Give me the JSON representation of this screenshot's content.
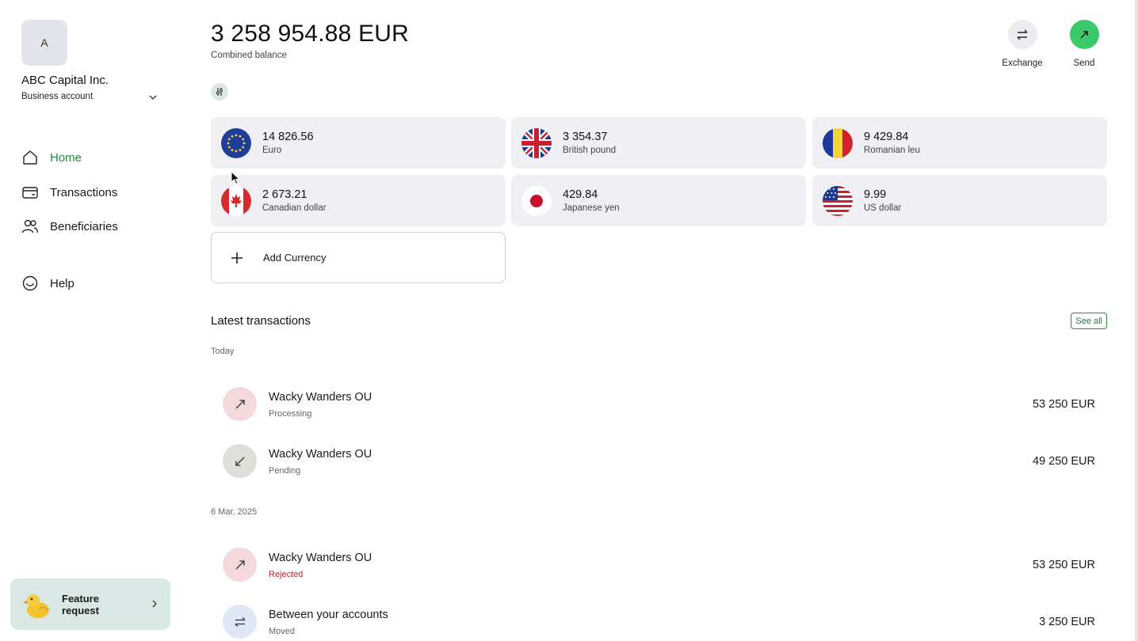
{
  "sidebar": {
    "avatar_letter": "A",
    "company_name": "ABC Capital Inc.",
    "account_type": "Business account",
    "nav": [
      {
        "label": "Home",
        "icon": "home-icon",
        "active": true
      },
      {
        "label": "Transactions",
        "icon": "card-icon"
      },
      {
        "label": "Beneficiaries",
        "icon": "users-icon"
      },
      {
        "label": "Help",
        "icon": "smiley-icon"
      }
    ],
    "feature_request": {
      "label": "Feature request",
      "icon": "duck-icon"
    }
  },
  "header": {
    "combined_balance": "3 258 954.88 EUR",
    "combined_balance_label": "Combined balance",
    "actions": [
      {
        "label": "Exchange",
        "icon": "exchange-icon",
        "color": "#ececf0"
      },
      {
        "label": "Send",
        "icon": "send-arrow-icon",
        "color": "#3cc96a"
      }
    ]
  },
  "currencies": [
    {
      "amount": "14 826.56",
      "name": "Euro",
      "flag": "eu-flag-icon"
    },
    {
      "amount": "3 354.37",
      "name": "British pound",
      "flag": "uk-flag-icon"
    },
    {
      "amount": "9 429.84",
      "name": "Romanian leu",
      "flag": "romania-flag-icon"
    },
    {
      "amount": "2 673.21",
      "name": "Canadian dollar",
      "flag": "canada-flag-icon"
    },
    {
      "amount": "429.84",
      "name": "Japanese yen",
      "flag": "japan-flag-icon"
    },
    {
      "amount": "9.99",
      "name": "US dollar",
      "flag": "us-flag-icon"
    }
  ],
  "add_currency_label": "Add Currency",
  "transactions": {
    "title": "Latest transactions",
    "see_all_label": "See all",
    "groups": [
      {
        "date": "Today",
        "items": [
          {
            "name": "Wacky Wanders OU",
            "status": "Processing",
            "amount": "53 250 EUR",
            "icon": "outgoing-arrow-icon",
            "bg": "#f3d9dc"
          },
          {
            "name": "Wacky Wanders OU",
            "status": "Pending",
            "amount": "49 250 EUR",
            "icon": "incoming-arrow-icon",
            "bg": "#dedfd9"
          }
        ]
      },
      {
        "date": "6 Mar, 2025",
        "items": [
          {
            "name": "Wacky Wanders OU",
            "status": "Rejected",
            "amount": "53 250 EUR",
            "icon": "outgoing-arrow-icon",
            "bg": "#f3d9dc"
          },
          {
            "name": "Between your accounts",
            "status": "Moved",
            "amount": "3 250 EUR",
            "icon": "exchange-icon",
            "bg": "#dfe6f4"
          }
        ]
      }
    ]
  },
  "colors": {
    "accent_green": "#1f8a3a",
    "rejected_red": "#c0262c"
  }
}
